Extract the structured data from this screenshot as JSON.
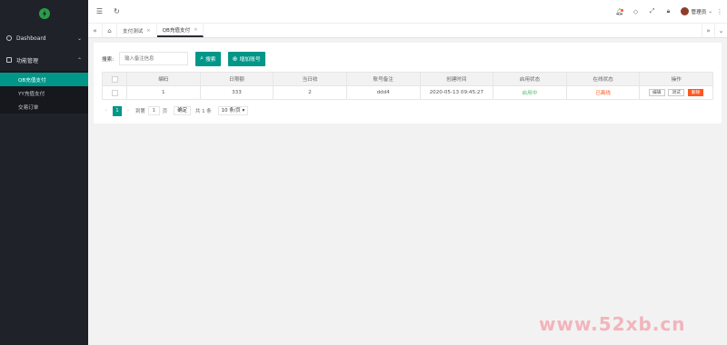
{
  "sidebar": {
    "groups": [
      {
        "label": "Dashboard",
        "chevron": "⌄"
      },
      {
        "label": "功能管理",
        "chevron": "⌃"
      }
    ],
    "items": [
      {
        "label": "QB充值支付"
      },
      {
        "label": "YY充值支付"
      },
      {
        "label": "交易订单"
      }
    ]
  },
  "topbar": {
    "user_name": "管理员",
    "icons": [
      "menu-toggle-icon",
      "refresh-icon",
      "bell-icon",
      "tag-icon",
      "fullscreen-icon",
      "lock-icon",
      "more-icon"
    ]
  },
  "tabs": [
    {
      "label": "支付测试"
    },
    {
      "label": "QB充值支付"
    }
  ],
  "search": {
    "label": "搜索:",
    "placeholder": "输入备注信息",
    "search_button": "搜索",
    "add_button": "增加账号"
  },
  "table": {
    "headers": [
      "编码",
      "日限额",
      "当日收",
      "账号备注",
      "创建时间",
      "启用状态",
      "在线状态",
      "操作"
    ],
    "rows": [
      {
        "id": "1",
        "daily_limit": "333",
        "today": "2",
        "remark": "ddd4",
        "created": "2020-05-13 09:45:27",
        "enabled": "启用中",
        "online": "已离线",
        "actions": [
          "编辑",
          "测试",
          "删除"
        ]
      }
    ]
  },
  "pager": {
    "prev": "‹",
    "current": "1",
    "next": "›",
    "goto_label": "到第",
    "page_input": "1",
    "page_unit": "页",
    "confirm": "确定",
    "total": "共 1 条",
    "page_size": "10 条/页"
  },
  "watermark": "www.52xb.cn",
  "colors": {
    "sidebar_bg": "#20222a",
    "accent": "#009688",
    "danger": "#ff5722",
    "success": "#5fb878"
  }
}
